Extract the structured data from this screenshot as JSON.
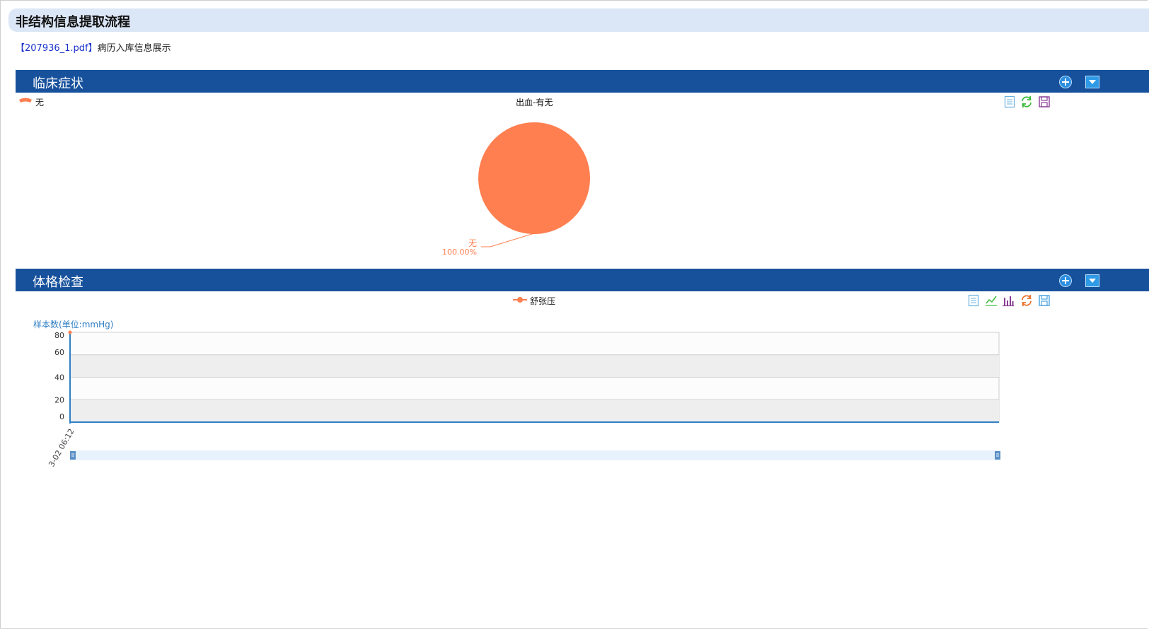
{
  "page": {
    "title": "非结构信息提取流程",
    "file_link": "【207936_1.pdf】",
    "subtitle": "病历入库信息展示"
  },
  "sections": [
    {
      "label": "临床症状"
    },
    {
      "label": "体格检查"
    }
  ],
  "icons": {
    "add": "plus-circle-icon",
    "collapse": "dropdown-arrow-icon",
    "data_view": "data-view-icon",
    "line_chart": "line-chart-icon",
    "bar_chart": "bar-chart-icon",
    "restore": "refresh-icon",
    "save_image": "save-icon"
  },
  "colors": {
    "title_bg": "#dbe6f6",
    "section_bg": "#17519c",
    "series": "#ff7f50",
    "axis": "#2f7fc4",
    "file_link": "#1a33cc"
  },
  "chart_data": [
    {
      "type": "pie",
      "title": "出血-有无",
      "legend": [
        "无"
      ],
      "legend_position": "top-left",
      "slices": [
        {
          "name": "无",
          "value": 1,
          "percent": "100.00%"
        }
      ]
    },
    {
      "type": "line",
      "legend": [
        "舒张压"
      ],
      "legend_position": "top-center",
      "ylabel": "样本数(单位:mmHg)",
      "yticks": [
        "80",
        "60",
        "40",
        "20",
        "0"
      ],
      "ylim": [
        0,
        80
      ],
      "xticks": [
        "3-02 06:12"
      ],
      "grid": true,
      "series": [
        {
          "name": "舒张压",
          "x": [
            "3-02 06:12"
          ],
          "values": [
            80
          ]
        }
      ],
      "datazoom": true
    }
  ]
}
